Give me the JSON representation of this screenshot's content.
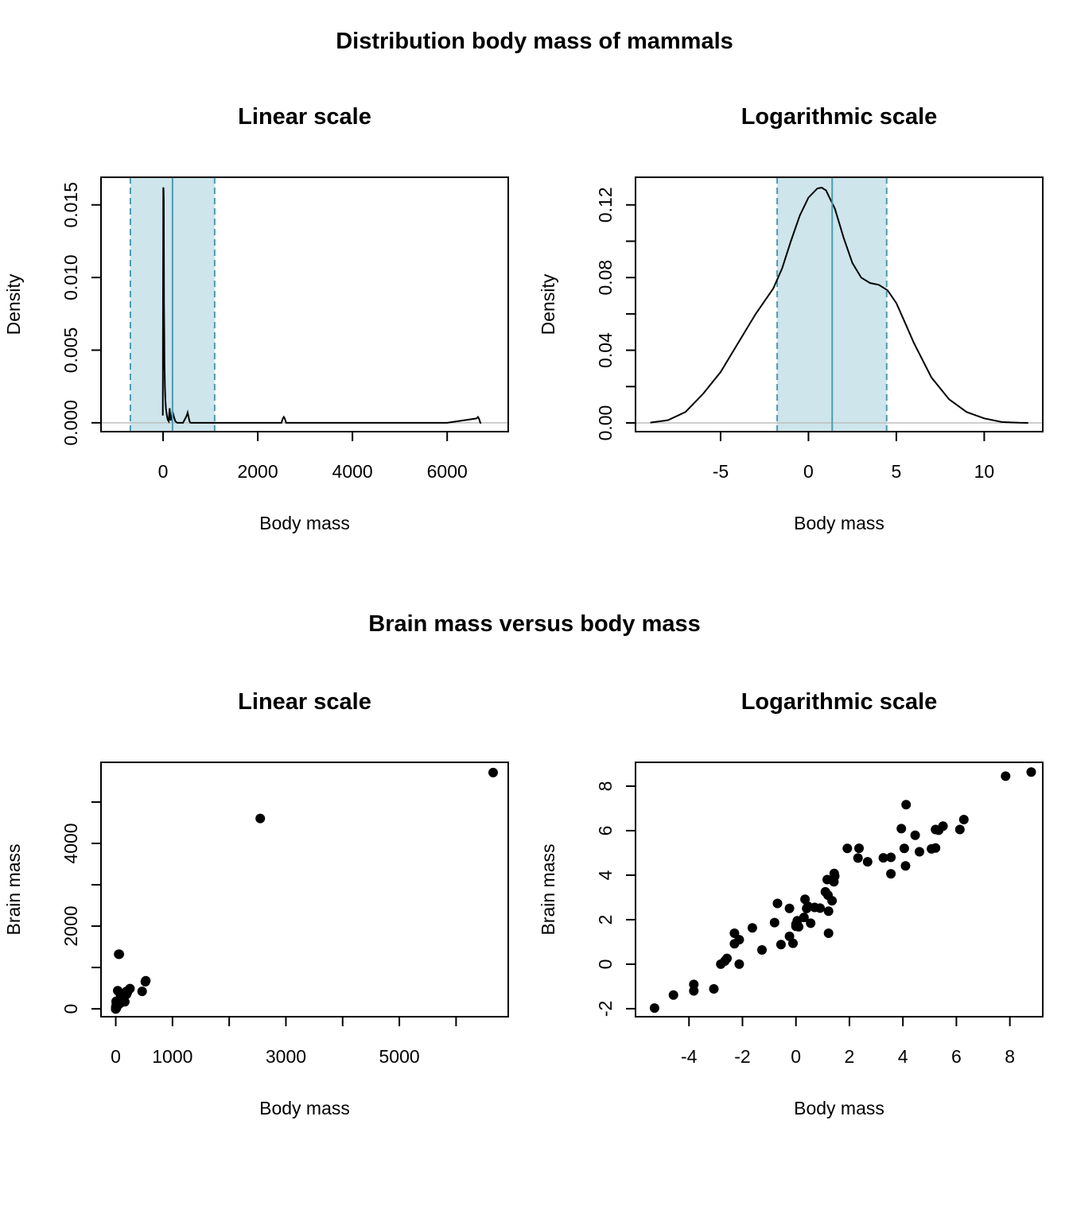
{
  "figure": {
    "suptitle_top": "Distribution body mass of mammals",
    "suptitle_bottom": "Brain mass versus body mass"
  },
  "colors": {
    "band_fill": "#cde5eb",
    "band_line": "#4c9bb0",
    "curve": "#000000",
    "baseline": "#bebebe",
    "points": "#000000"
  },
  "chart_data": [
    {
      "id": "density-linear",
      "type": "line",
      "title": "Linear scale",
      "xlabel": "Body mass",
      "ylabel": "Density",
      "xlim": [
        -1310,
        7290
      ],
      "ylim": [
        -0.00061,
        0.0169
      ],
      "xticks": [
        0,
        2000,
        4000,
        6000
      ],
      "xtick_labels": [
        "0",
        "2000",
        "4000",
        "6000"
      ],
      "yticks": [
        0,
        0.005,
        0.01,
        0.015
      ],
      "ytick_labels": [
        "0.000",
        "0.005",
        "0.010",
        "0.015"
      ],
      "band": {
        "lower": -690,
        "upper": 1090,
        "center": 200
      },
      "x": [
        -5,
        0,
        5,
        10,
        15,
        20,
        25,
        30,
        40,
        50,
        60,
        80,
        100,
        120,
        140,
        160,
        180,
        200,
        230,
        260,
        300,
        350,
        420,
        470,
        500,
        520,
        540,
        560,
        580,
        620,
        700,
        2000,
        2500,
        2530,
        2550,
        2570,
        2600,
        2700,
        6000,
        6620,
        6650,
        6670,
        6700,
        6720
      ],
      "y": [
        0.0005,
        0.0092,
        0.0162,
        0.0161,
        0.0154,
        0.0082,
        0.0064,
        0.004,
        0.0024,
        0.0015,
        0.001,
        0.0005,
        0.0002,
        0.0001,
        0.001,
        0.0002,
        0.0002,
        0.0008,
        0.0004,
        0.0001,
        0.0,
        0.0,
        0.0,
        0.0003,
        0.0005,
        0.0007,
        0.0004,
        0.0001,
        0.0,
        0.0,
        0.0,
        0.0,
        0.0,
        0.0003,
        0.0004,
        0.0003,
        0.0,
        0.0,
        0.0,
        0.0003,
        0.0004,
        0.0003,
        0.0,
        0.0
      ]
    },
    {
      "id": "density-log",
      "type": "line",
      "title": "Logarithmic scale",
      "xlabel": "Body mass",
      "ylabel": "Density",
      "xlim": [
        -9.84,
        13.33
      ],
      "ylim": [
        -0.0048,
        0.1352
      ],
      "xticks": [
        -5,
        0,
        5,
        10
      ],
      "xtick_labels": [
        "-5",
        "0",
        "5",
        "10"
      ],
      "yticks": [
        0,
        0.02,
        0.04,
        0.06,
        0.08,
        0.1,
        0.12
      ],
      "ytick_labels": [
        "0.00",
        "",
        "0.04",
        "",
        "0.08",
        "",
        "0.12"
      ],
      "band": {
        "lower": -1.78,
        "upper": 4.45,
        "center": 1.35
      },
      "x": [
        -9.0,
        -8.0,
        -7.0,
        -6.0,
        -5.0,
        -4.0,
        -3.0,
        -2.0,
        -1.5,
        -1.0,
        -0.5,
        0.0,
        0.5,
        0.75,
        1.0,
        1.5,
        2.0,
        2.5,
        3.0,
        3.5,
        4.0,
        4.5,
        5.0,
        5.5,
        6.0,
        7.0,
        8.0,
        9.0,
        10.0,
        11.0,
        12.0,
        12.5
      ],
      "y": [
        0.0002,
        0.0015,
        0.006,
        0.016,
        0.028,
        0.044,
        0.06,
        0.074,
        0.085,
        0.1,
        0.114,
        0.124,
        0.129,
        0.1295,
        0.128,
        0.118,
        0.102,
        0.088,
        0.08,
        0.077,
        0.076,
        0.073,
        0.066,
        0.055,
        0.044,
        0.025,
        0.013,
        0.006,
        0.0025,
        0.0005,
        0.0001,
        0.0
      ]
    },
    {
      "id": "scatter-linear",
      "type": "scatter",
      "title": "Linear scale",
      "xlabel": "Body mass",
      "ylabel": "Brain mass",
      "xlim": [
        -260,
        6920
      ],
      "ylim": [
        -190,
        5960
      ],
      "xticks": [
        0,
        1000,
        2000,
        3000,
        4000,
        5000,
        6000
      ],
      "xtick_labels": [
        "0",
        "1000",
        "",
        "3000",
        "",
        "5000",
        ""
      ],
      "yticks": [
        0,
        1000,
        2000,
        3000,
        4000,
        5000
      ],
      "ytick_labels": [
        "0",
        "",
        "2000",
        "",
        "4000",
        ""
      ],
      "points": [
        [
          6654,
          5712
        ],
        [
          2547,
          4603
        ],
        [
          52,
          1320
        ],
        [
          521,
          655
        ],
        [
          529,
          680
        ],
        [
          465,
          423
        ],
        [
          187,
          419
        ],
        [
          207,
          406
        ],
        [
          160,
          169
        ],
        [
          85,
          325
        ],
        [
          35,
          440
        ],
        [
          100,
          179
        ],
        [
          60,
          115
        ],
        [
          27,
          115
        ],
        [
          10,
          179
        ],
        [
          0.12,
          1
        ],
        [
          3.3,
          25.6
        ],
        [
          1.4,
          11.4
        ],
        [
          0.06,
          0.33
        ],
        [
          0.75,
          12.3
        ],
        [
          0.2,
          5
        ],
        [
          3.5,
          3.9
        ],
        [
          55.5,
          175
        ],
        [
          3.6,
          21
        ],
        [
          4.2,
          50.4
        ],
        [
          6.8,
          179
        ],
        [
          1.04,
          5.5
        ],
        [
          4.19,
          58
        ],
        [
          0.43,
          6.4
        ],
        [
          0.1,
          4
        ],
        [
          3.0,
          10.8
        ],
        [
          0.07,
          0.2
        ],
        [
          2.0,
          12.3
        ],
        [
          1.6,
          6.3
        ],
        [
          0.02,
          0.4
        ],
        [
          3.38,
          44.5
        ],
        [
          0.28,
          1.9
        ],
        [
          0.92,
          5.7
        ],
        [
          0.12,
          3.0
        ],
        [
          10.55,
          115
        ],
        [
          36.33,
          119.5
        ],
        [
          62,
          1320
        ],
        [
          250,
          490
        ],
        [
          120,
          280
        ],
        [
          190,
          350
        ],
        [
          0.01,
          0.25
        ],
        [
          0.05,
          0.3
        ],
        [
          0.1,
          2.5
        ],
        [
          1.6,
          11.4
        ],
        [
          0.9,
          2.6
        ],
        [
          101,
          157
        ],
        [
          0.55,
          2.4
        ],
        [
          4.05,
          17
        ],
        [
          0.21,
          1.8
        ],
        [
          0.75,
          2.6
        ],
        [
          2.5,
          12.1
        ],
        [
          0.005,
          0.14
        ],
        [
          100,
          179
        ],
        [
          14,
          25
        ],
        [
          4.5,
          17.5
        ]
      ]
    },
    {
      "id": "scatter-log",
      "type": "scatter",
      "title": "Logarithmic scale",
      "xlabel": "Body mass",
      "ylabel": "Brain mass",
      "xlim": [
        -6.0,
        9.23
      ],
      "ylim": [
        -2.36,
        9.07
      ],
      "xticks": [
        -4,
        -2,
        0,
        2,
        4,
        6,
        8
      ],
      "xtick_labels": [
        "-4",
        "-2",
        "0",
        "2",
        "4",
        "6",
        "8"
      ],
      "yticks": [
        -2,
        0,
        2,
        4,
        6,
        8
      ],
      "ytick_labels": [
        "-2",
        "0",
        "2",
        "4",
        "6",
        "8"
      ],
      "points": [
        [
          -5.29,
          -1.97
        ],
        [
          -4.58,
          -1.39
        ],
        [
          -3.82,
          -0.91
        ],
        [
          -3.82,
          -1.2
        ],
        [
          -3.07,
          -1.11
        ],
        [
          -2.81,
          0.0
        ],
        [
          -2.66,
          0.14
        ],
        [
          -2.58,
          0.26
        ],
        [
          -2.3,
          1.39
        ],
        [
          -2.3,
          0.92
        ],
        [
          -2.12,
          1.1
        ],
        [
          -2.12,
          0.0
        ],
        [
          -1.63,
          1.63
        ],
        [
          -1.27,
          0.64
        ],
        [
          -0.8,
          1.87
        ],
        [
          -0.69,
          2.73
        ],
        [
          -0.56,
          0.88
        ],
        [
          -0.24,
          2.51
        ],
        [
          -0.24,
          1.25
        ],
        [
          -0.11,
          0.94
        ],
        [
          0.0,
          1.79
        ],
        [
          0.0,
          1.7
        ],
        [
          0.05,
          1.95
        ],
        [
          0.1,
          1.68
        ],
        [
          0.3,
          2.1
        ],
        [
          0.34,
          2.92
        ],
        [
          0.4,
          2.5
        ],
        [
          0.45,
          2.6
        ],
        [
          0.55,
          1.84
        ],
        [
          0.7,
          2.55
        ],
        [
          0.9,
          2.52
        ],
        [
          1.1,
          3.25
        ],
        [
          1.17,
          3.8
        ],
        [
          1.2,
          3.1
        ],
        [
          1.22,
          2.38
        ],
        [
          1.22,
          1.39
        ],
        [
          1.35,
          2.85
        ],
        [
          1.42,
          3.7
        ],
        [
          1.43,
          4.08
        ],
        [
          1.45,
          3.95
        ],
        [
          1.92,
          5.2
        ],
        [
          2.32,
          4.77
        ],
        [
          2.36,
          5.21
        ],
        [
          2.68,
          4.6
        ],
        [
          3.27,
          4.78
        ],
        [
          3.55,
          4.8
        ],
        [
          3.55,
          4.06
        ],
        [
          3.94,
          6.09
        ],
        [
          4.05,
          5.2
        ],
        [
          4.1,
          4.42
        ],
        [
          4.12,
          7.17
        ],
        [
          4.46,
          5.79
        ],
        [
          4.62,
          5.05
        ],
        [
          5.07,
          5.18
        ],
        [
          5.22,
          5.22
        ],
        [
          5.22,
          6.05
        ],
        [
          5.34,
          6.02
        ],
        [
          5.5,
          6.2
        ],
        [
          6.13,
          6.05
        ],
        [
          6.28,
          6.5
        ],
        [
          7.84,
          8.45
        ],
        [
          8.8,
          8.63
        ]
      ]
    }
  ]
}
